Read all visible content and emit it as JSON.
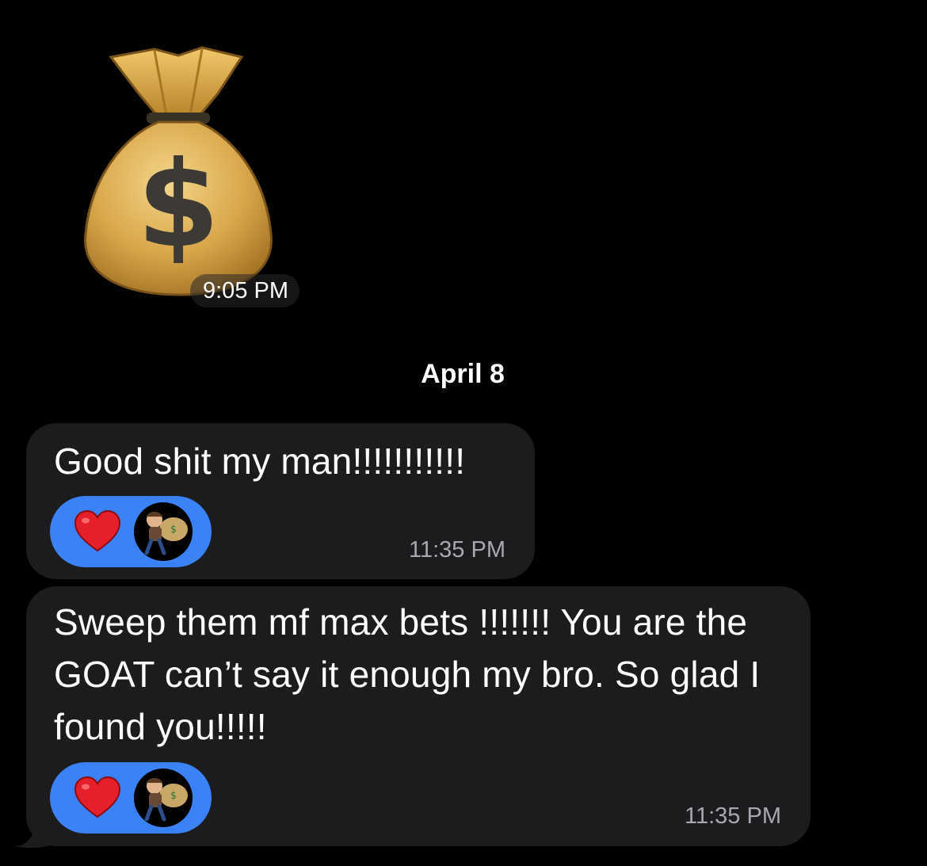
{
  "messages": [
    {
      "type": "emoji",
      "icon": "money-bag-icon",
      "time": "9:05 PM"
    },
    {
      "type": "date-separator",
      "label": "April 8"
    },
    {
      "type": "text",
      "text": "Good shit my man!!!!!!!!!!!",
      "reactions": [
        "heart-icon",
        "avatar"
      ],
      "time": "11:35 PM"
    },
    {
      "type": "text",
      "text": "Sweep them mf max bets !!!!!!! You are the GOAT can’t say it enough my bro. So glad I found you!!!!!",
      "reactions": [
        "heart-icon",
        "avatar"
      ],
      "time": "11:35 PM"
    }
  ],
  "colors": {
    "background": "#000000",
    "bubble": "#1c1c1e",
    "reaction_pill": "#3b82f6",
    "heart": "#e5202a",
    "timestamp": "#a8a8ad"
  }
}
